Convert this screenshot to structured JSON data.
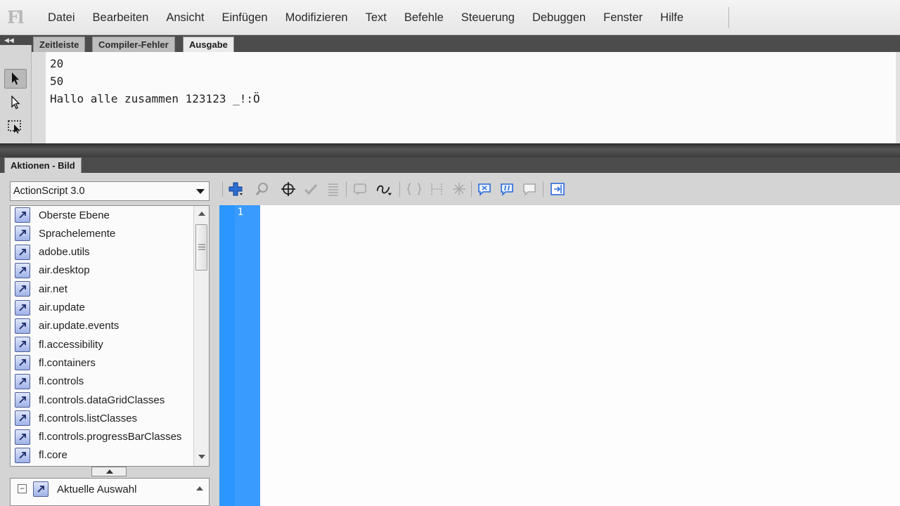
{
  "app": {
    "logo": "Fl"
  },
  "menu": [
    "Datei",
    "Bearbeiten",
    "Ansicht",
    "Einfügen",
    "Modifizieren",
    "Text",
    "Befehle",
    "Steuerung",
    "Debuggen",
    "Fenster",
    "Hilfe"
  ],
  "output_panel": {
    "tabs": [
      "Zeitleiste",
      "Compiler-Fehler",
      "Ausgabe"
    ],
    "active_tab": "Ausgabe",
    "lines": [
      "20",
      "50",
      "Hallo alle zusammen 123123 _!:Ö"
    ]
  },
  "actions_panel": {
    "title": "Aktionen - Bild",
    "language_select": "ActionScript 3.0",
    "tree_items": [
      "Oberste Ebene",
      "Sprachelemente",
      "adobe.utils",
      "air.desktop",
      "air.net",
      "air.update",
      "air.update.events",
      "fl.accessibility",
      "fl.containers",
      "fl.controls",
      "fl.controls.dataGridClasses",
      "fl.controls.listClasses",
      "fl.controls.progressBarClasses",
      "fl.core"
    ],
    "lower_tree": {
      "item": "Aktuelle Auswahl",
      "expander": "−"
    },
    "line_number": "1"
  },
  "colors": {
    "gutter": "#2b96ff",
    "panel_dark": "#4c4c4c",
    "menubar": "#eeeeee"
  }
}
